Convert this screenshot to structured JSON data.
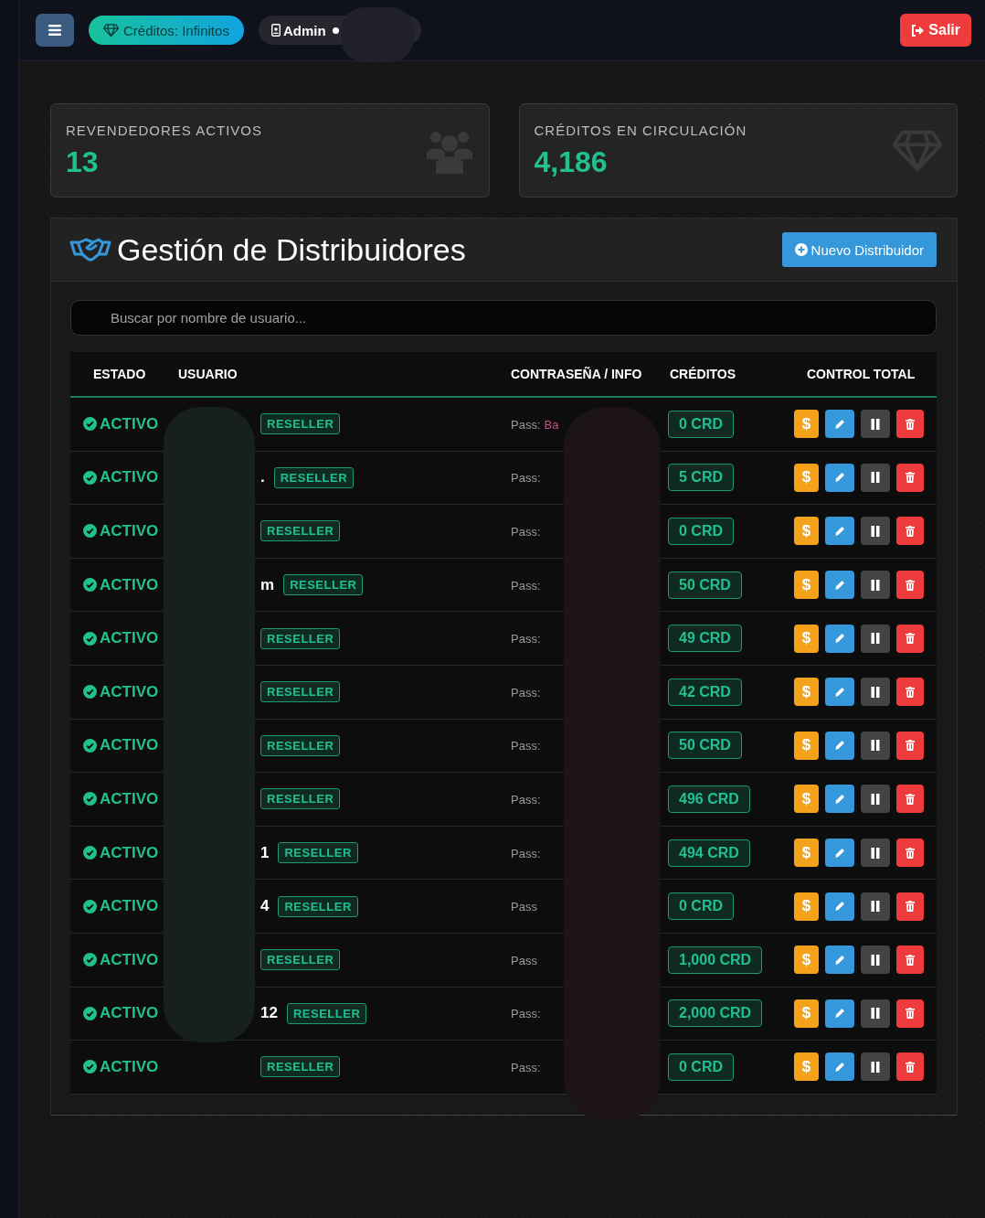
{
  "topbar": {
    "credits_badge": "Créditos: Infinitos",
    "user_label": "Admin",
    "online": true,
    "logout": "Salir"
  },
  "stats": [
    {
      "kind": "users",
      "label": "REVENDEDORES ACTIVOS",
      "value": "13"
    },
    {
      "kind": "gem",
      "label": "CRÉDITOS EN CIRCULACIÓN",
      "value": "4,186"
    }
  ],
  "panel": {
    "title": "Gestión de Distribuidores",
    "new_button": "Nuevo Distribuidor",
    "search": {
      "placeholder": "Buscar por nombre de usuario..."
    },
    "columns": [
      "ESTADO",
      "USUARIO",
      "CONTRASEÑA / INFO",
      "CRÉDITOS",
      "CONTROL TOTAL"
    ],
    "rows": [
      {
        "status": "ACTIVO",
        "active": true,
        "user": "",
        "role": "RESELLER",
        "pass_label": "Pass:",
        "pass": "Ba",
        "credits": "0 CRD",
        "actions": [
          "$"
        ]
      },
      {
        "status": "ACTIVO",
        "active": true,
        "user": ".",
        "role": "RESELLER",
        "pass_label": "Pass:",
        "pass": "",
        "credits": "5 CRD",
        "actions": [
          "$"
        ]
      },
      {
        "status": "ACTIVO",
        "active": true,
        "user": "",
        "role": "RESELLER",
        "pass_label": "Pass:",
        "pass": "",
        "credits": "0 CRD",
        "actions": [
          "$"
        ]
      },
      {
        "status": "ACTIVO",
        "active": true,
        "user": "m",
        "role": "RESELLER",
        "pass_label": "Pass:",
        "pass": "",
        "credits": "50 CRD",
        "actions": [
          "$"
        ]
      },
      {
        "status": "ACTIVO",
        "active": true,
        "user": "",
        "role": "RESELLER",
        "pass_label": "Pass:",
        "pass": "",
        "credits": "49 CRD",
        "actions": [
          "$"
        ]
      },
      {
        "status": "ACTIVO",
        "active": true,
        "user": "",
        "role": "RESELLER",
        "pass_label": "Pass:",
        "pass": "",
        "credits": "42 CRD",
        "actions": [
          "$"
        ]
      },
      {
        "status": "ACTIVO",
        "active": true,
        "user": "",
        "role": "RESELLER",
        "pass_label": "Pass:",
        "pass": "",
        "credits": "50 CRD",
        "actions": [
          "$"
        ]
      },
      {
        "status": "ACTIVO",
        "active": true,
        "user": "",
        "role": "RESELLER",
        "pass_label": "Pass:",
        "pass": "",
        "credits": "496 CRD",
        "actions": [
          "$"
        ]
      },
      {
        "status": "ACTIVO",
        "active": true,
        "user": "1",
        "role": "RESELLER",
        "pass_label": "Pass:",
        "pass": "",
        "credits": "494 CRD",
        "actions": [
          "$"
        ]
      },
      {
        "status": "ACTIVO",
        "active": true,
        "user": "4",
        "role": "RESELLER",
        "pass_label": "Pass",
        "pass": "",
        "credits": "0 CRD",
        "actions": [
          "$"
        ]
      },
      {
        "status": "ACTIVO",
        "active": true,
        "user": "",
        "role": "RESELLER",
        "pass_label": "Pass",
        "pass": "",
        "credits": "1,000 CRD",
        "actions": [
          "$"
        ]
      },
      {
        "status": "ACTIVO",
        "active": true,
        "user": "12",
        "role": "RESELLER",
        "pass_label": "Pass:",
        "pass": "",
        "credits": "2,000 CRD",
        "actions": [
          "$"
        ]
      },
      {
        "status": "ACTIVO",
        "active": true,
        "user": "",
        "role": "RESELLER",
        "pass_label": "Pass:",
        "pass": "",
        "credits": "0 CRD",
        "actions": [
          "$"
        ]
      }
    ]
  },
  "redactions": [
    {
      "kind": "header"
    },
    {
      "kind": "user"
    },
    {
      "kind": "pass"
    }
  ]
}
